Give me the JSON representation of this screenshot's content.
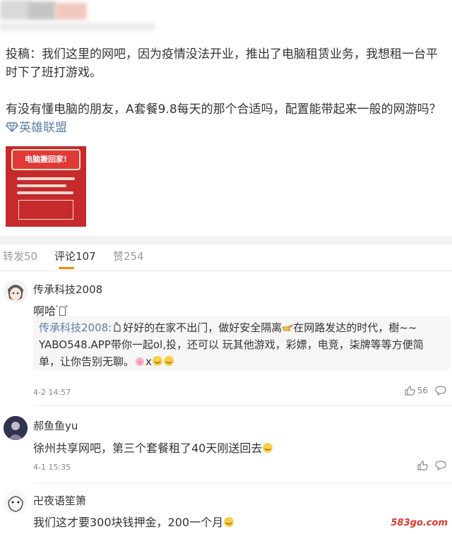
{
  "post": {
    "paragraph1": "投稿：我们这里的网吧，因为疫情没法开业，推出了电脑租赁业务，我想租一台平时下了班打游戏。",
    "paragraph2": "有没有懂电脑的朋友，A套餐9.8每天的那个合适吗，配置能带起来一般的网游吗？",
    "topic_link": "英雄联盟",
    "image_title": "电脑搬回家!"
  },
  "tabs": {
    "repost": "转发50",
    "comments": "评论107",
    "likes": "赞254"
  },
  "comments": [
    {
      "user": "传承科技2008",
      "text": "啊哈",
      "reply_user": "传承科技2008:",
      "reply_text_1": "好好的在家不出门，做好安全隔离",
      "reply_text_2": "在网路发达的时代，樹~~",
      "reply_line_2": "YABO548.APP带你一起ol,投，还可以 玩其他游戏，彩嫖，电竞，柒牌等等方便简",
      "reply_line_3": "单，让你告别无聊。",
      "reply_x": "x",
      "time": "4-2 14:57",
      "likes": "56"
    },
    {
      "user": "郝鱼鱼yu",
      "text": "徐州共享网吧，第三个套餐租了40天刚送回去",
      "time": "4-1 15:35"
    },
    {
      "user": "卍夜语笙箫",
      "text": "我们这才要300块钱押金，200一个月"
    }
  ],
  "watermark": "583go.com",
  "colors": {
    "link": "#5d7fa6",
    "tab_indicator": "#ff8200",
    "watermark": "#e0382d"
  }
}
